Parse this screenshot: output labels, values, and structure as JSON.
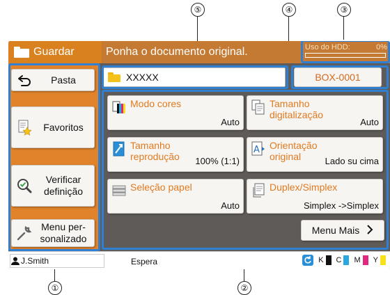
{
  "callouts": [
    "⑤",
    "④",
    "③",
    "①",
    "②"
  ],
  "header": {
    "mode_label": "Guardar",
    "message": "Ponha o documento original.",
    "hdd_label": "Uso do HDD:",
    "hdd_percent": "0%",
    "hdd_usage_fraction": 0.0
  },
  "left_menu": {
    "folder_label": "Pasta",
    "favorites_label": "Favoritos",
    "check_label_line1": "Verificar",
    "check_label_line2": "definição",
    "custom_label_line1": "Menu per-",
    "custom_label_line2": "sonalizado"
  },
  "folder": {
    "name": "XXXXX",
    "box_id": "BOX-0001"
  },
  "settings": [
    {
      "title": "Modo cores",
      "value": "Auto"
    },
    {
      "title": "Tamanho digitalização",
      "value": "Auto"
    },
    {
      "title": "Tamanho reprodução",
      "value": "100% (1:1)"
    },
    {
      "title": "Orientação original",
      "value": "Lado su cima"
    },
    {
      "title": "Seleção papel",
      "value": "Auto"
    },
    {
      "title": "Duplex/Simplex",
      "value": "Simplex ->Simplex"
    }
  ],
  "more_menu_label": "Menu Mais",
  "status": {
    "user": "J.Smith",
    "state": "Espera",
    "inks": [
      {
        "label": "K",
        "color": "#111111"
      },
      {
        "label": "C",
        "color": "#2aa7e0"
      },
      {
        "label": "M",
        "color": "#e0287f"
      },
      {
        "label": "Y",
        "color": "#f5e21b"
      }
    ]
  },
  "colors": {
    "accent": "#d9801f",
    "highlight": "#2f7fd2",
    "label_orange": "#e07a20"
  }
}
